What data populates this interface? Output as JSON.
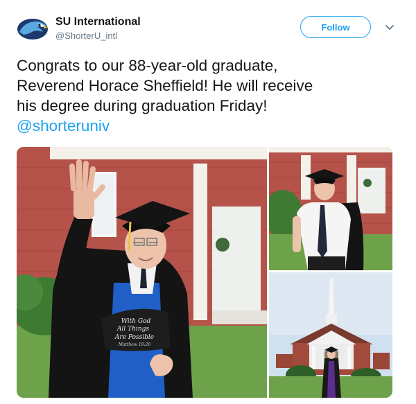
{
  "account": {
    "name": "SU International",
    "handle": "@ShorterU_intl",
    "avatar_icon": "eagle-logo-icon"
  },
  "follow": {
    "label": "Follow"
  },
  "menu": {
    "icon": "chevron-down-icon"
  },
  "tweet": {
    "lines": [
      "Congrats to our 88-year-old graduate,",
      "Reverend Horace Sheffield! He will receive",
      "his degree during graduation Friday!"
    ],
    "mention": "@shorteruniv"
  },
  "media": {
    "sign_lines": [
      "With God",
      "All Things",
      "Are Possible",
      "Matthew 19:26"
    ]
  },
  "colors": {
    "accent": "#1da1f2",
    "text": "#14171a",
    "secondary": "#657786"
  }
}
